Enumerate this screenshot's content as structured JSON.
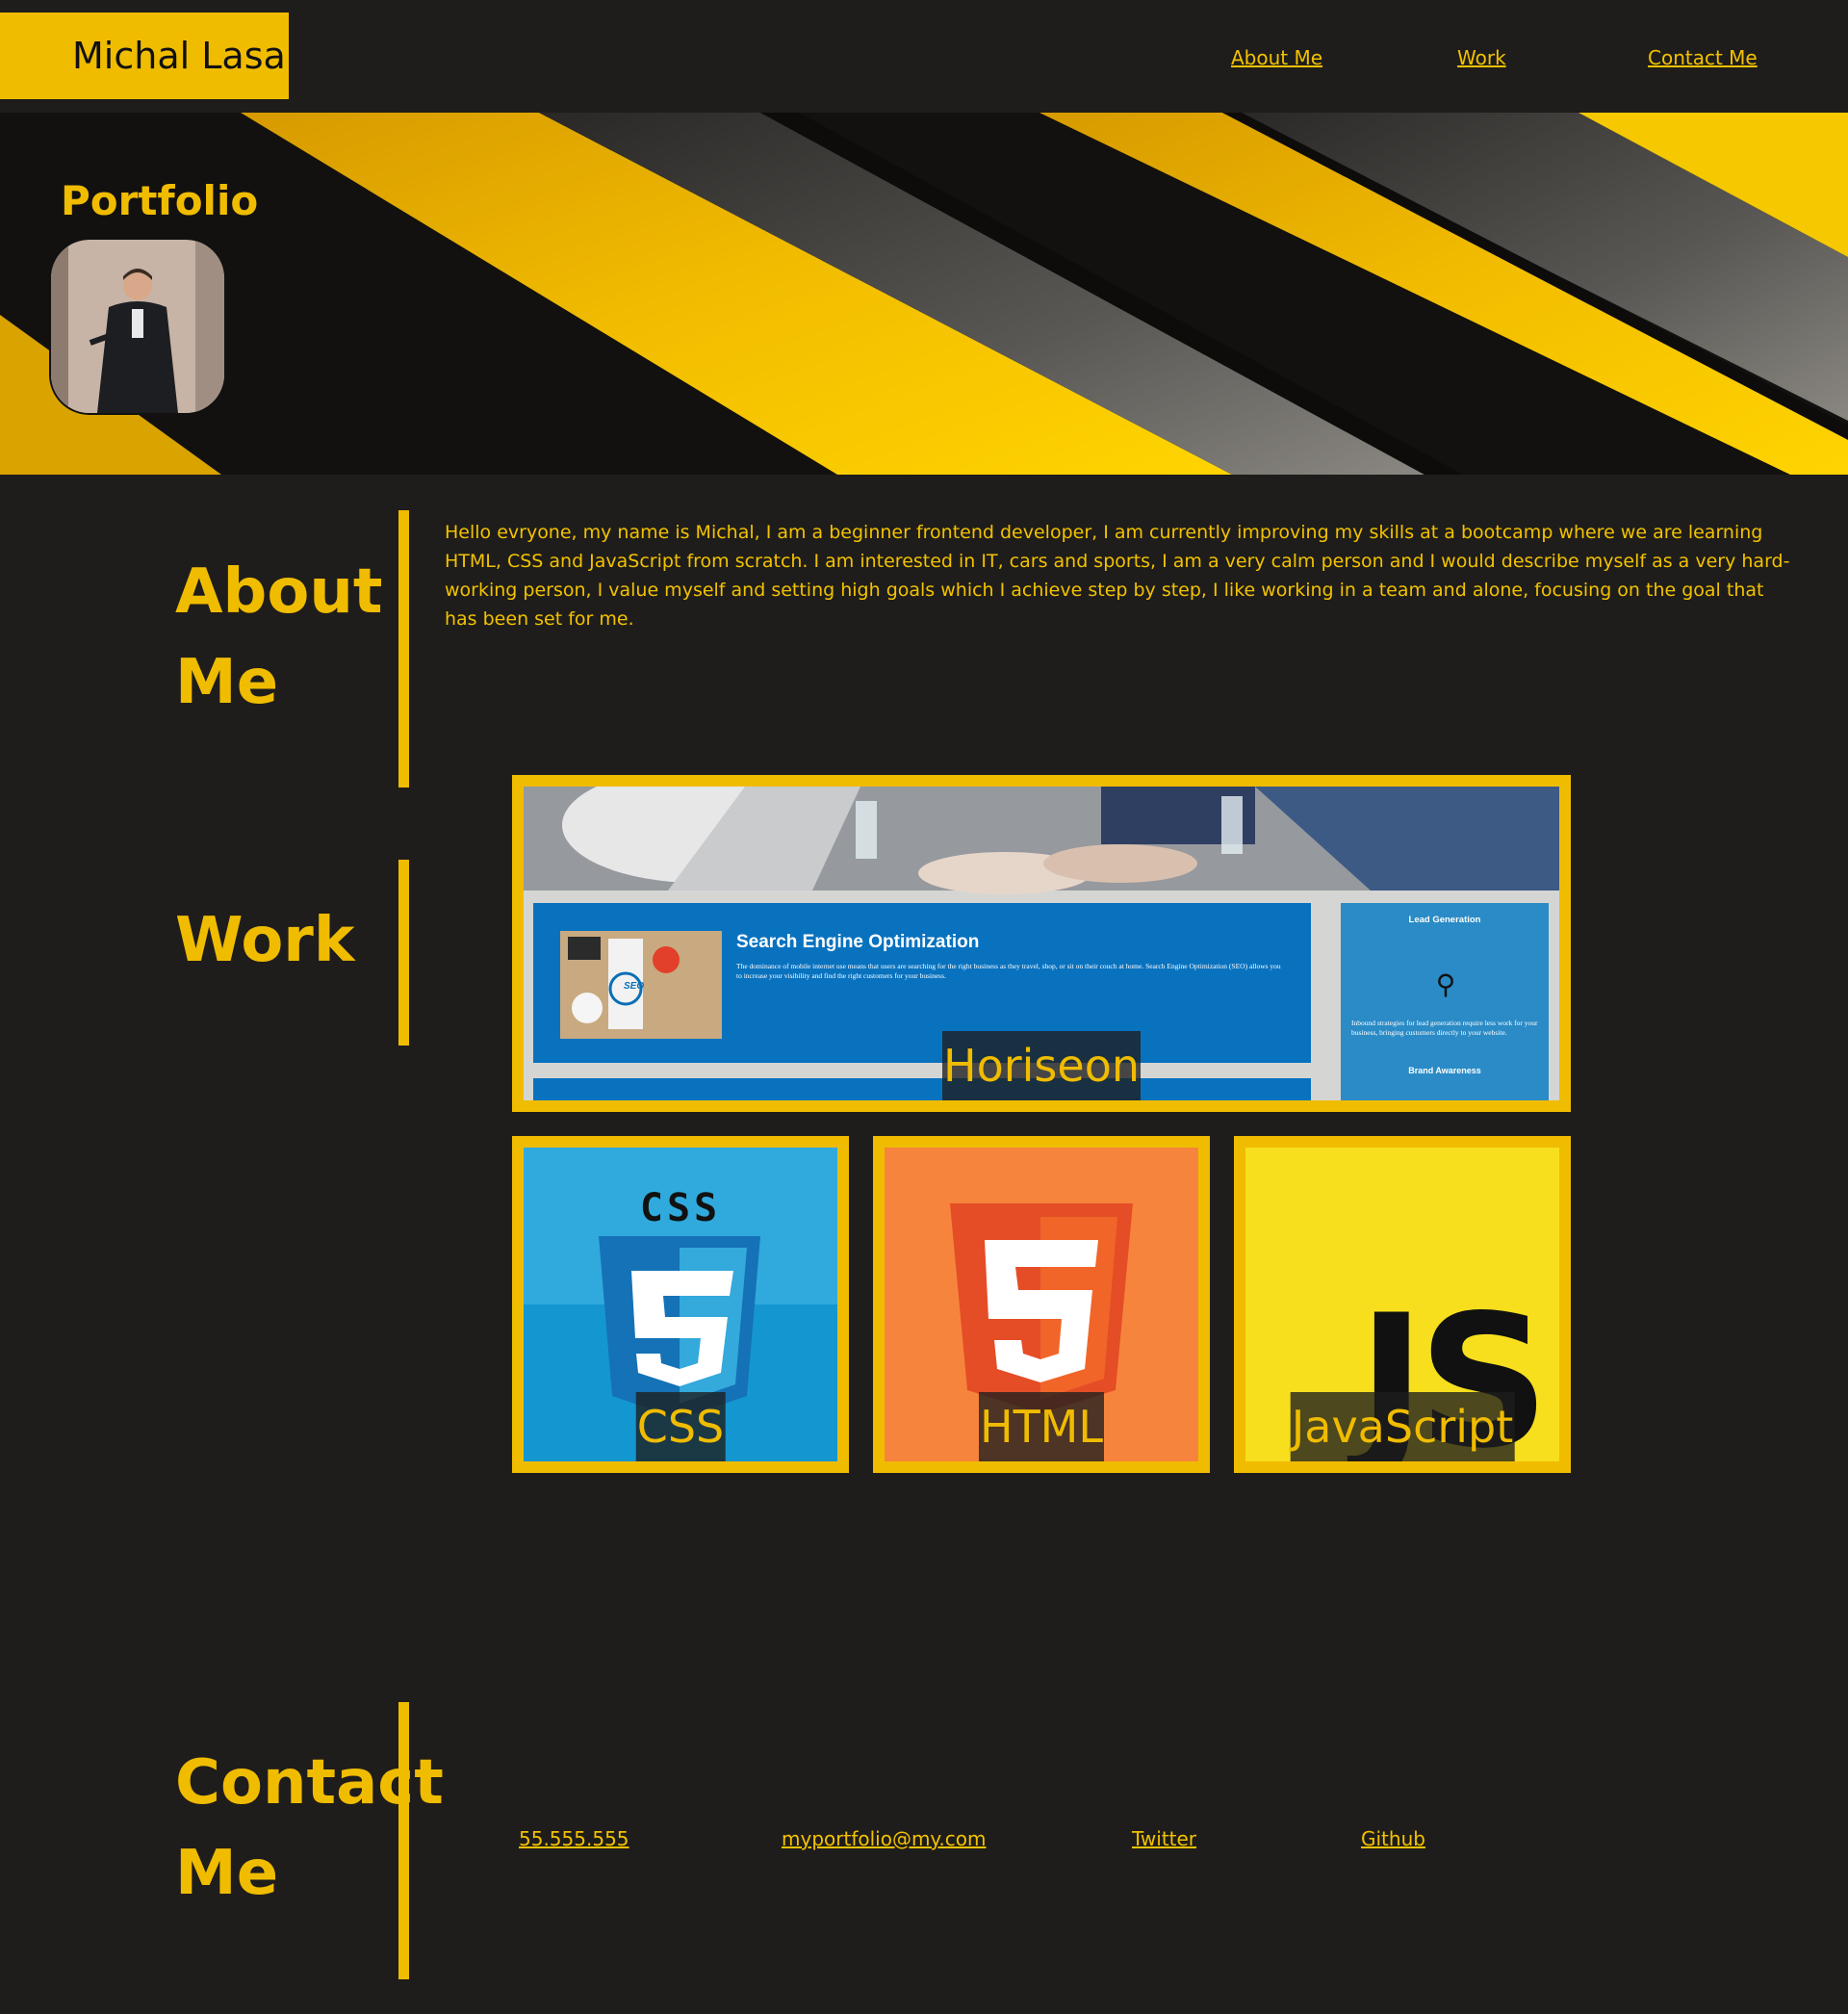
{
  "header": {
    "logo": "Michal Lasa",
    "nav": [
      "About Me",
      "Work",
      "Contact Me"
    ]
  },
  "hero": {
    "title": "Portfolio"
  },
  "about": {
    "title_line1": "About",
    "title_line2": "Me",
    "text": "Hello evryone, my name is Michal, I am a beginner frontend developer, I am currently improving my skills at a bootcamp where we are learning HTML, CSS and JavaScript from scratch. I am interested in IT, cars and sports, I am a very calm person and I would describe myself as a very hard-working person, I value myself and setting high goals which I achieve step by step, I like working in a team and alone, focusing on the goal that has been set for me."
  },
  "work": {
    "title": "Work",
    "featured": {
      "label": "Horiseon",
      "preview_heading": "Search Engine Optimization",
      "preview_body": "The dominance of mobile internet use means that users are searching for the right business as they travel, shop, or sit on their couch at home. Search Engine Optimization (SEO) allows you to increase your visibility and find the right customers for your business.",
      "side_heading": "Lead Generation",
      "side_body": "Inbound strategies for lead generation require less work for your business, bringing customers directly to your website.",
      "side_footer": "Brand Awareness",
      "seo_badge": "SEO"
    },
    "projects": [
      {
        "label": "CSS",
        "logo_text": "CSS",
        "digit": "3"
      },
      {
        "label": "HTML",
        "digit": "5"
      },
      {
        "label": "JavaScript",
        "logo_text": "JS"
      }
    ]
  },
  "contact": {
    "title_line1": "Contact",
    "title_line2": "Me",
    "links": [
      "55.555.555",
      "myportfolio@my.com",
      "Twitter",
      "Github"
    ]
  },
  "colors": {
    "accent": "#f0bc00",
    "background": "#1f1d1b"
  }
}
